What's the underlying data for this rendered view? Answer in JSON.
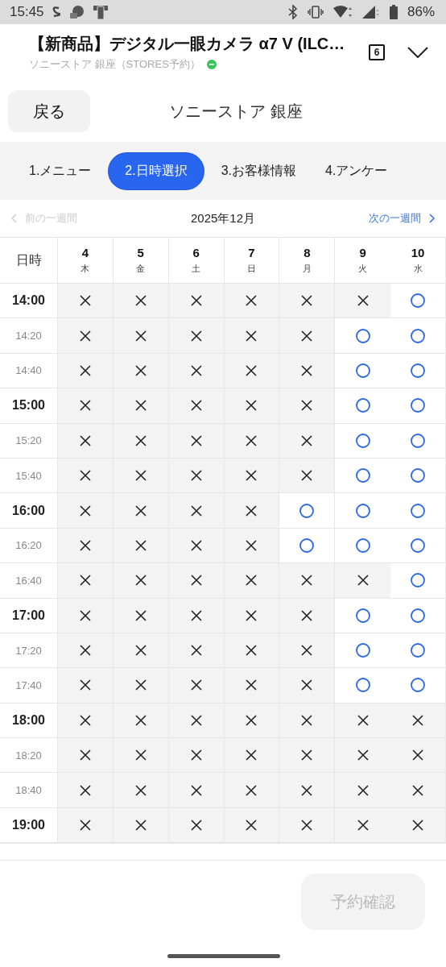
{
  "status_bar": {
    "time": "15:45",
    "battery": "86%"
  },
  "header": {
    "title": "【新商品】デジタル一眼カメラ α7 V (ILC…",
    "subtitle": "ソニーストア 銀座（STORES予約）",
    "tab_count": "6"
  },
  "toolbar": {
    "back_button": "戻る",
    "store_name": "ソニーストア 銀座"
  },
  "steps": [
    {
      "label": "1.メニュー",
      "selected": false
    },
    {
      "label": "2.日時選択",
      "selected": true
    },
    {
      "label": "3.お客様情報",
      "selected": false
    },
    {
      "label": "4.アンケー",
      "selected": false
    }
  ],
  "week_nav": {
    "prev": "前の一週間",
    "prev_disabled": true,
    "month": "2025年12月",
    "next": "次の一週間"
  },
  "grid": {
    "corner": "日時",
    "days": [
      {
        "date": "4",
        "weekday": "木"
      },
      {
        "date": "5",
        "weekday": "金"
      },
      {
        "date": "6",
        "weekday": "土"
      },
      {
        "date": "7",
        "weekday": "日"
      },
      {
        "date": "8",
        "weekday": "月"
      },
      {
        "date": "9",
        "weekday": "火"
      },
      {
        "date": "10",
        "weekday": "水"
      }
    ],
    "rows": [
      {
        "time": "14:00",
        "kind": "hour",
        "slots": [
          {
            "available": false
          },
          {
            "available": false
          },
          {
            "available": false
          },
          {
            "available": false
          },
          {
            "available": false
          },
          {
            "available": false
          },
          {
            "available": true
          }
        ]
      },
      {
        "time": "14:20",
        "kind": "minute",
        "slots": [
          {
            "available": false
          },
          {
            "available": false
          },
          {
            "available": false
          },
          {
            "available": false
          },
          {
            "available": false
          },
          {
            "available": true
          },
          {
            "available": true
          }
        ]
      },
      {
        "time": "14:40",
        "kind": "minute",
        "slots": [
          {
            "available": false
          },
          {
            "available": false
          },
          {
            "available": false
          },
          {
            "available": false
          },
          {
            "available": false
          },
          {
            "available": true
          },
          {
            "available": true
          }
        ]
      },
      {
        "time": "15:00",
        "kind": "hour",
        "slots": [
          {
            "available": false
          },
          {
            "available": false
          },
          {
            "available": false
          },
          {
            "available": false
          },
          {
            "available": false
          },
          {
            "available": true
          },
          {
            "available": true
          }
        ]
      },
      {
        "time": "15:20",
        "kind": "minute",
        "slots": [
          {
            "available": false
          },
          {
            "available": false
          },
          {
            "available": false
          },
          {
            "available": false
          },
          {
            "available": false
          },
          {
            "available": true
          },
          {
            "available": true
          }
        ]
      },
      {
        "time": "15:40",
        "kind": "minute",
        "slots": [
          {
            "available": false
          },
          {
            "available": false
          },
          {
            "available": false
          },
          {
            "available": false
          },
          {
            "available": false
          },
          {
            "available": true
          },
          {
            "available": true
          }
        ]
      },
      {
        "time": "16:00",
        "kind": "hour",
        "slots": [
          {
            "available": false
          },
          {
            "available": false
          },
          {
            "available": false
          },
          {
            "available": false
          },
          {
            "available": true
          },
          {
            "available": true
          },
          {
            "available": true
          }
        ]
      },
      {
        "time": "16:20",
        "kind": "minute",
        "slots": [
          {
            "available": false
          },
          {
            "available": false
          },
          {
            "available": false
          },
          {
            "available": false
          },
          {
            "available": true
          },
          {
            "available": true
          },
          {
            "available": true
          }
        ]
      },
      {
        "time": "16:40",
        "kind": "minute",
        "slots": [
          {
            "available": false
          },
          {
            "available": false
          },
          {
            "available": false
          },
          {
            "available": false
          },
          {
            "available": false
          },
          {
            "available": false
          },
          {
            "available": true
          }
        ]
      },
      {
        "time": "17:00",
        "kind": "hour",
        "slots": [
          {
            "available": false
          },
          {
            "available": false
          },
          {
            "available": false
          },
          {
            "available": false
          },
          {
            "available": false
          },
          {
            "available": true
          },
          {
            "available": true
          }
        ]
      },
      {
        "time": "17:20",
        "kind": "minute",
        "slots": [
          {
            "available": false
          },
          {
            "available": false
          },
          {
            "available": false
          },
          {
            "available": false
          },
          {
            "available": false
          },
          {
            "available": true
          },
          {
            "available": true
          }
        ]
      },
      {
        "time": "17:40",
        "kind": "minute",
        "slots": [
          {
            "available": false
          },
          {
            "available": false
          },
          {
            "available": false
          },
          {
            "available": false
          },
          {
            "available": false
          },
          {
            "available": true
          },
          {
            "available": true
          }
        ]
      },
      {
        "time": "18:00",
        "kind": "hour",
        "slots": [
          {
            "available": false
          },
          {
            "available": false
          },
          {
            "available": false
          },
          {
            "available": false
          },
          {
            "available": false
          },
          {
            "available": false
          },
          {
            "available": false
          }
        ]
      },
      {
        "time": "18:20",
        "kind": "minute",
        "slots": [
          {
            "available": false
          },
          {
            "available": false
          },
          {
            "available": false
          },
          {
            "available": false
          },
          {
            "available": false
          },
          {
            "available": false
          },
          {
            "available": false
          }
        ]
      },
      {
        "time": "18:40",
        "kind": "minute",
        "slots": [
          {
            "available": false
          },
          {
            "available": false
          },
          {
            "available": false
          },
          {
            "available": false
          },
          {
            "available": false
          },
          {
            "available": false
          },
          {
            "available": false
          }
        ]
      },
      {
        "time": "19:00",
        "kind": "hour",
        "slots": [
          {
            "available": false
          },
          {
            "available": false
          },
          {
            "available": false
          },
          {
            "available": false
          },
          {
            "available": false
          },
          {
            "available": false
          },
          {
            "available": false
          }
        ]
      }
    ]
  },
  "footer": {
    "confirm_button": "予約確認",
    "disabled": true
  }
}
